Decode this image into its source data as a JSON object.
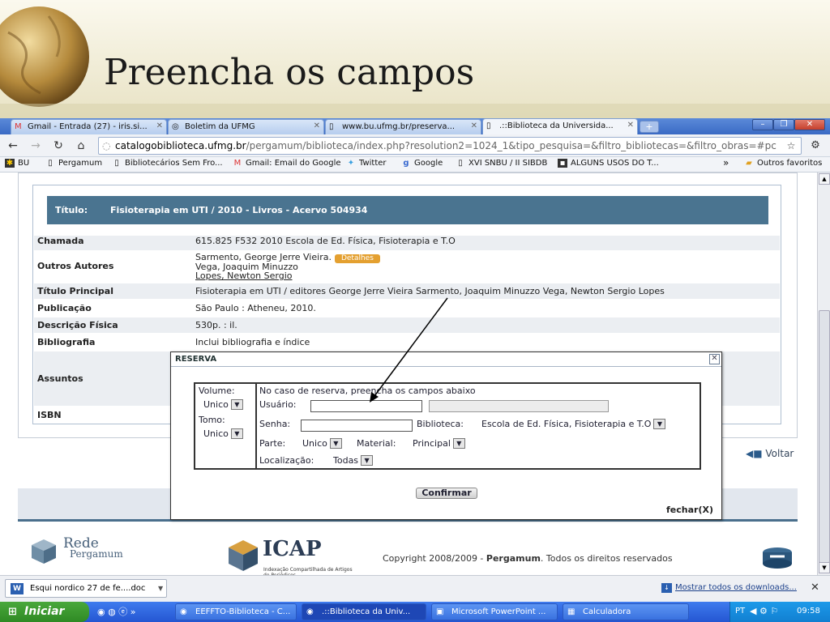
{
  "slide": {
    "title": "Preencha os campos"
  },
  "browser": {
    "tabs": [
      {
        "label": "Gmail - Entrada (27) - iris.si...",
        "icon": "gmail-icon",
        "active": false
      },
      {
        "label": "Boletim da UFMG",
        "icon": "page-icon",
        "active": false
      },
      {
        "label": "www.bu.ufmg.br/preserva...",
        "icon": "page-icon",
        "active": false
      },
      {
        "label": ".::Biblioteca da Universida...",
        "icon": "page-icon",
        "active": true
      }
    ],
    "window_buttons": [
      "–",
      "❐",
      "✕"
    ],
    "url_host": "catalogobiblioteca.ufmg.br",
    "url_rest": "/pergamum/biblioteca/index.php?resolution2=1024_1&tipo_pesquisa=&filtro_bibliotecas=&filtro_obras=#pc",
    "bookmarks": [
      {
        "label": "BU",
        "icon": "bu-icon"
      },
      {
        "label": "Pergamum",
        "icon": "page-icon"
      },
      {
        "label": "Bibliotecários Sem Fro...",
        "icon": "page-icon"
      },
      {
        "label": "Gmail: Email do Google",
        "icon": "gmail-icon"
      },
      {
        "label": "Twitter",
        "icon": "twitter-icon"
      },
      {
        "label": "Google",
        "icon": "google-icon"
      },
      {
        "label": "XVI SNBU / II SIBDB",
        "icon": "page-icon"
      },
      {
        "label": "ALGUNS USOS DO T...",
        "icon": "page-icon"
      }
    ],
    "bookmarks_more": "»",
    "other_bookmarks": "Outros favoritos"
  },
  "record": {
    "title_label": "Título:",
    "title_value": "Fisioterapia em UTI / 2010 - Livros - Acervo 504934",
    "rows": {
      "chamada": {
        "label": "Chamada",
        "value": "615.825  F532  2010  Escola de Ed. Física, Fisioterapia e T.O"
      },
      "outros": {
        "label": "Outros Autores",
        "value1": "Sarmento, George Jerre Vieira.",
        "value2": "Vega, Joaquim Minuzzo",
        "value3": "Lopes, Newton Sergio",
        "detalhes": "Detalhes"
      },
      "titulo": {
        "label": "Título Principal",
        "value": "Fisioterapia em UTI /   editores George Jerre Vieira Sarmento, Joaquim Minuzzo Vega, Newton Sergio Lopes"
      },
      "publicacao": {
        "label": "Publicação",
        "value": "São Paulo :   Atheneu,   2010."
      },
      "descricao": {
        "label": "Descrição Física",
        "value": "530p. :   il."
      },
      "bibliografia": {
        "label": "Bibliografia",
        "value": "Inclui bibliografia e índice"
      },
      "assuntos": {
        "label": "Assuntos",
        "value": ""
      },
      "isbn": {
        "label": "ISBN",
        "value": ""
      }
    },
    "voltar": "Voltar"
  },
  "footer": {
    "rede_title": "Rede",
    "rede_sub": "Pergamum",
    "icap_title": "ICAP",
    "icap_sub": "Indexação Compartilhada de Artigos de Periódicos",
    "copyright_prefix": "Copyright 2008/2009 - ",
    "copyright_brand": "Pergamum",
    "copyright_suffix": ". Todos os direitos reservados"
  },
  "modal": {
    "title": "RESERVA",
    "close": "✕",
    "volume_label": "Volume:",
    "volume_value": "Unico",
    "tomo_label": "Tomo:",
    "tomo_value": "Unico",
    "instruction": "No caso de reserva, preencha os campos abaixo",
    "usuario_label": "Usuário:",
    "usuario_value": "",
    "senha_label": "Senha:",
    "senha_value": "",
    "biblioteca_label": "Biblioteca:",
    "biblioteca_value": "Escola de Ed. Física, Fisioterapia e T.O",
    "parte_label": "Parte:",
    "parte_value": "Unico",
    "material_label": "Material:",
    "material_value": "Principal",
    "localizacao_label": "Localização:",
    "localizacao_value": "Todas",
    "confirm": "Confirmar",
    "fechar": "fechar(X)"
  },
  "downloads": {
    "item": "Esqui nordico  27 de fe....doc",
    "show_all": "Mostrar todos os downloads...",
    "close": "✕"
  },
  "taskbar": {
    "start": "Iniciar",
    "more": "»",
    "tasks": [
      {
        "label": "EEFFTO-Biblioteca - C...",
        "active": false
      },
      {
        "label": ".::Biblioteca da Univ...",
        "active": true
      },
      {
        "label": "Microsoft PowerPoint ...",
        "active": false
      },
      {
        "label": "Calculadora",
        "active": false
      }
    ],
    "lang": "PT",
    "clock": "09:58"
  },
  "colors": {
    "record_header": "#4a7490",
    "detalhes": "#e4a030",
    "taskbar": "#2456d2",
    "start": "#2f8a24"
  }
}
